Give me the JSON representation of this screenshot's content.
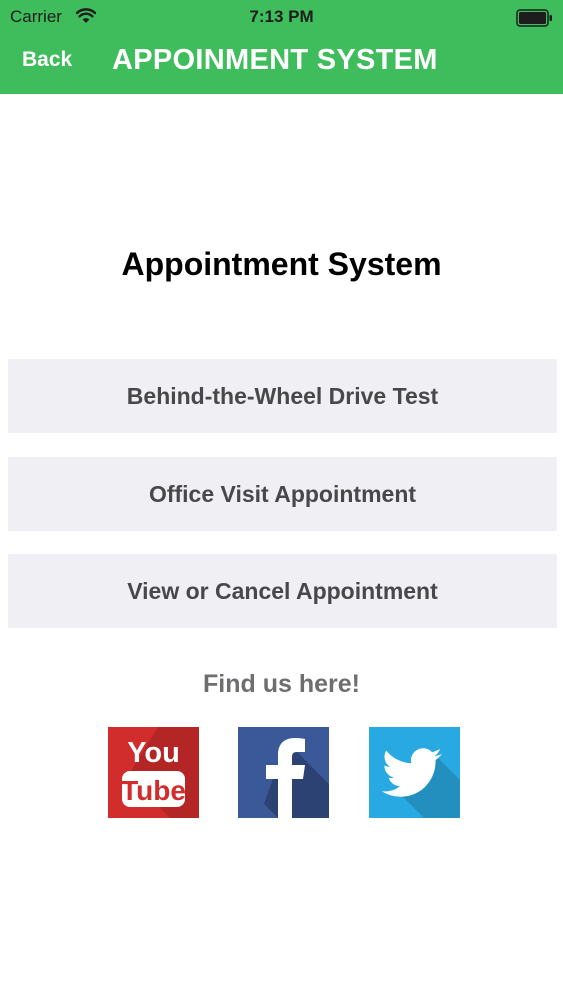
{
  "status_bar": {
    "carrier": "Carrier",
    "time": "7:13 PM"
  },
  "nav": {
    "back_label": "Back",
    "title": "APPOINMENT SYSTEM"
  },
  "page": {
    "title": "Appointment System"
  },
  "menu": [
    {
      "label": "Behind-the-Wheel Drive Test"
    },
    {
      "label": "Office Visit Appointment"
    },
    {
      "label": "View or Cancel Appointment"
    }
  ],
  "social": {
    "heading": "Find us here!",
    "icons": [
      {
        "name": "youtube-icon",
        "text_top": "You",
        "text_bottom": "Tube",
        "color": "#d22d2d"
      },
      {
        "name": "facebook-icon",
        "color": "#3b5998"
      },
      {
        "name": "twitter-icon",
        "color": "#29a9e1"
      }
    ]
  },
  "colors": {
    "header": "#3fbd5c",
    "button_bg": "#efeff4",
    "button_text": "#48484a"
  }
}
